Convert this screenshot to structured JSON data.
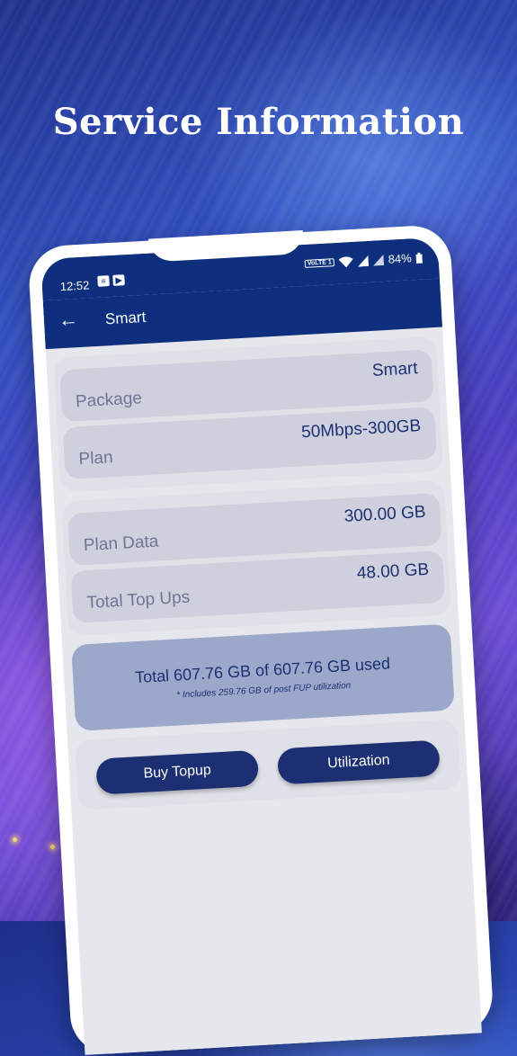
{
  "promo": {
    "headline": "Service Information"
  },
  "status_bar": {
    "time": "12:52",
    "volte": "VoLTE 1",
    "battery": "84%"
  },
  "toolbar": {
    "back_icon": "←",
    "title": "Smart"
  },
  "package_group": {
    "rows": [
      {
        "label": "Package",
        "value": "Smart"
      },
      {
        "label": "Plan",
        "value": "50Mbps-300GB"
      }
    ]
  },
  "data_group": {
    "rows": [
      {
        "label": "Plan Data",
        "value": "300.00 GB"
      },
      {
        "label": "Total Top Ups",
        "value": "48.00 GB"
      }
    ]
  },
  "usage": {
    "total_text": "Total 607.76 GB of 607.76 GB used",
    "note": "* Includes 259.76 GB of post FUP utilization"
  },
  "actions": {
    "buy_topup": "Buy Topup",
    "utilization": "Utilization"
  },
  "colors": {
    "app_bar": "#0e2f7d",
    "accent": "#1b2f72",
    "row_bg": "#cfd0de",
    "usage_bg": "#9ca8c9"
  }
}
